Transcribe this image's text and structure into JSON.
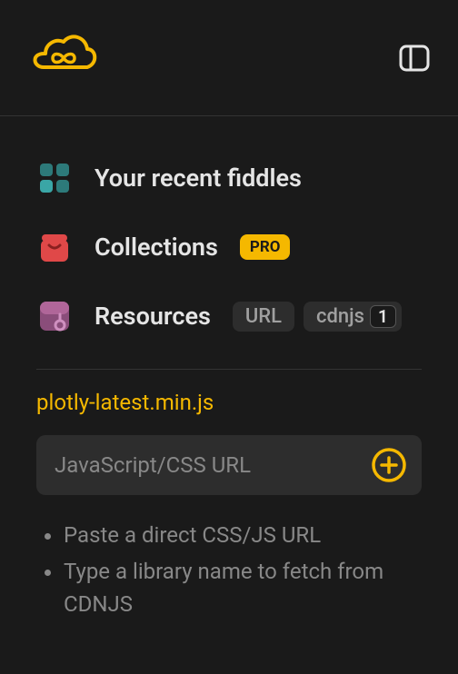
{
  "nav": {
    "recent_fiddles": "Your recent fiddles",
    "collections": "Collections",
    "pro_badge": "PRO",
    "resources": "Resources",
    "url_tag": "URL",
    "cdnjs_tag": "cdnjs",
    "cdnjs_count": "1"
  },
  "resource": {
    "entry": "plotly-latest.min.js"
  },
  "input": {
    "placeholder": "JavaScript/CSS URL"
  },
  "hints": {
    "item1": "Paste a direct CSS/JS URL",
    "item2": "Type a library name to fetch from CDNJS"
  }
}
